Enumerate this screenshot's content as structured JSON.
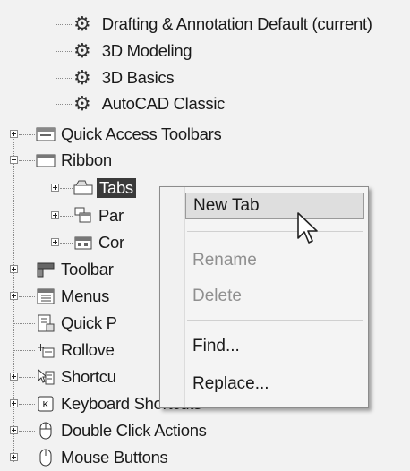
{
  "tree": {
    "workspaces": [
      {
        "label": "Drafting & Annotation Default (current)",
        "icon": "gear-icon"
      },
      {
        "label": "3D Modeling",
        "icon": "gear-icon"
      },
      {
        "label": "3D Basics",
        "icon": "gear-icon"
      },
      {
        "label": "AutoCAD Classic",
        "icon": "gear-icon"
      }
    ],
    "nodes": [
      {
        "label": "Quick Access Toolbars",
        "icon": "toolbar-icon",
        "state": "collapsed"
      },
      {
        "label": "Ribbon",
        "icon": "ribbon-icon",
        "state": "expanded"
      },
      {
        "label": "Tabs",
        "icon": "tabs-icon",
        "state": "collapsed",
        "selected": true
      },
      {
        "label": "Par",
        "icon": "panels-icon",
        "state": "collapsed"
      },
      {
        "label": "Cor",
        "icon": "contextual-tab-icon",
        "state": "collapsed"
      },
      {
        "label": "Toolbar",
        "icon": "toolbars-icon",
        "state": "collapsed"
      },
      {
        "label": "Menus",
        "icon": "menus-icon",
        "state": "collapsed"
      },
      {
        "label": "Quick P",
        "icon": "quick-properties-icon",
        "state": "leaf"
      },
      {
        "label": "Rollove",
        "icon": "rollover-icon",
        "state": "leaf"
      },
      {
        "label": "Shortcu",
        "icon": "shortcut-icon",
        "state": "collapsed"
      },
      {
        "label": "Keyboard Shortcuts",
        "icon": "keyboard-icon",
        "state": "collapsed"
      },
      {
        "label": "Double Click Actions",
        "icon": "mouse-icon",
        "state": "collapsed"
      },
      {
        "label": "Mouse Buttons",
        "icon": "mouse-icon",
        "state": "collapsed"
      }
    ]
  },
  "context_menu": {
    "items": [
      {
        "label": "New Tab",
        "enabled": true,
        "highlighted": true
      },
      {
        "label": "Rename",
        "enabled": false
      },
      {
        "label": "Delete",
        "enabled": false
      },
      {
        "label": "Find...",
        "enabled": true
      },
      {
        "label": "Replace...",
        "enabled": true
      }
    ]
  },
  "colors": {
    "background": "#f2f2f2",
    "menu_background": "#f4f4f4",
    "highlight": "#dedede",
    "selected_node": "#3a3a3a",
    "disabled_text": "#8f8f8f"
  }
}
